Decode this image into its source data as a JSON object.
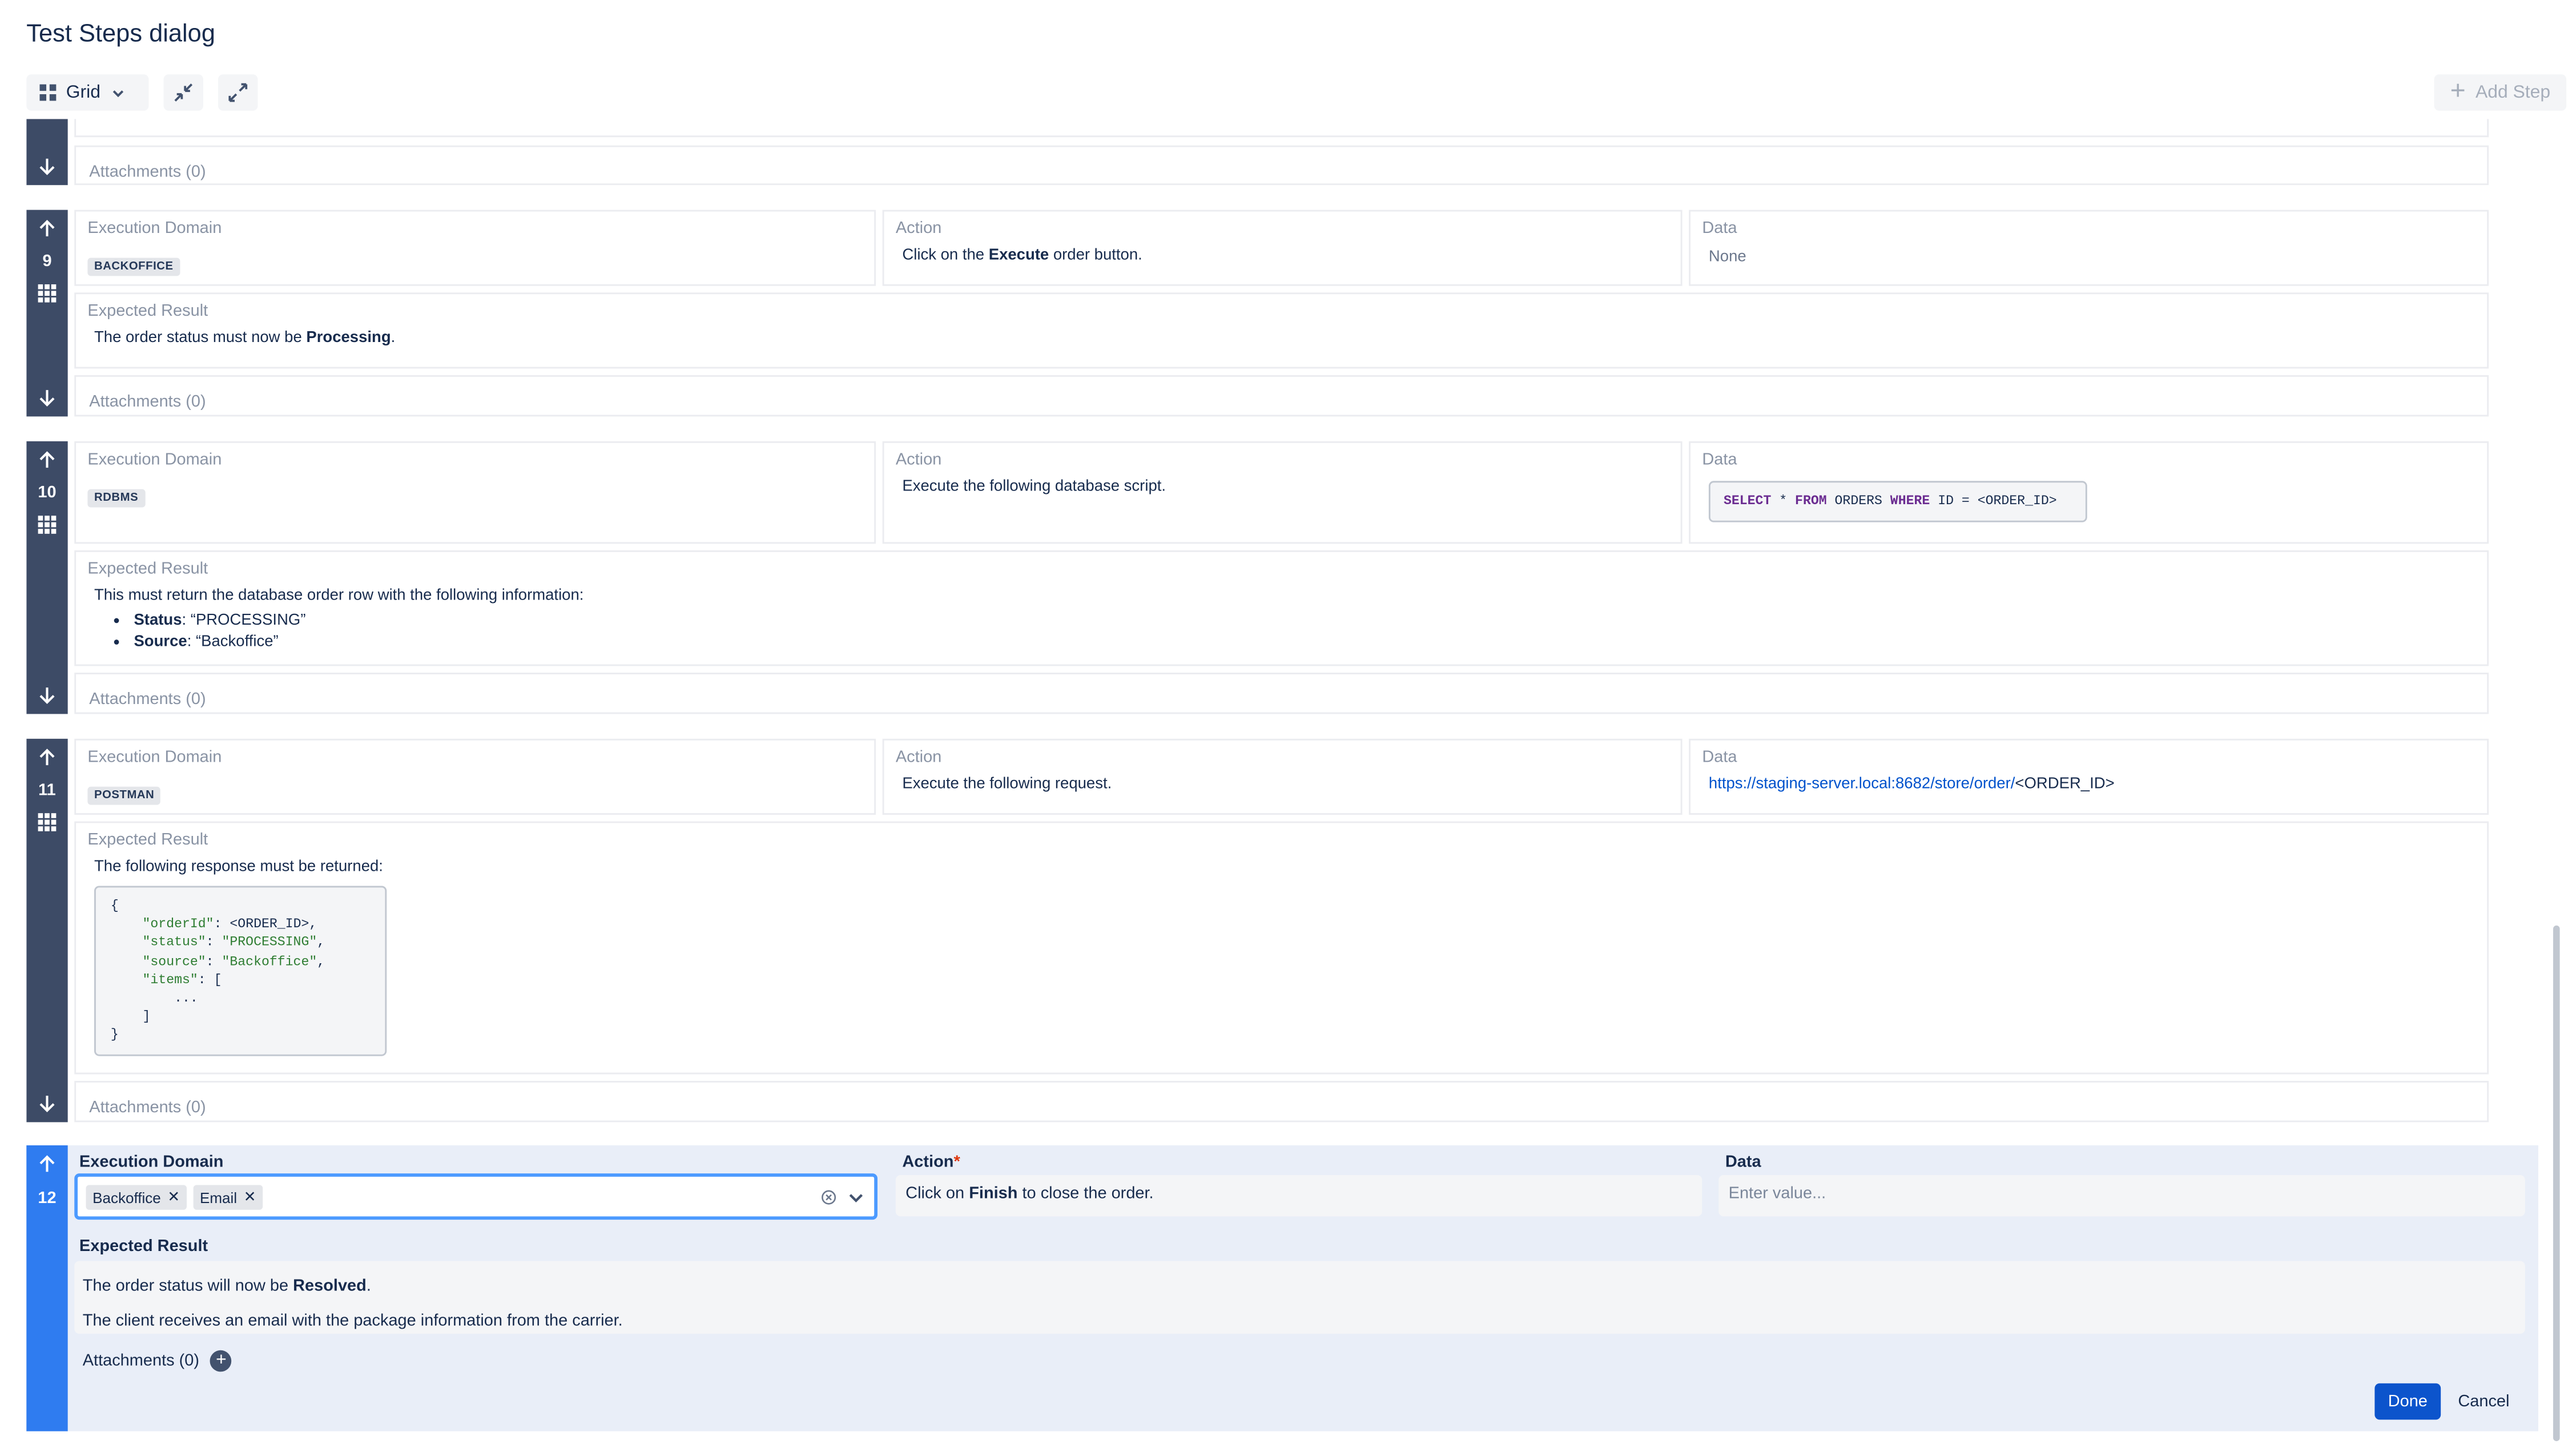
{
  "dialog": {
    "title": "Test Steps dialog"
  },
  "toolbar": {
    "view_label": "Grid",
    "add_step_label": "Add Step"
  },
  "labels": {
    "execution_domain": "Execution Domain",
    "action": "Action",
    "data": "Data",
    "expected_result": "Expected Result",
    "attachments": "Attachments (0)"
  },
  "steps": [
    {
      "number": "9",
      "domain_tag": "BACKOFFICE",
      "action_pre": "Click on the ",
      "action_bold": "Execute",
      "action_post": " order button.",
      "data": "None",
      "er_pre": "The order status must now be ",
      "er_bold": "Processing",
      "er_post": "."
    },
    {
      "number": "10",
      "domain_tag": "RDBMS",
      "action": "Execute the following database script.",
      "data_code": {
        "kw1": "SELECT",
        "star": " * ",
        "kw2": "FROM",
        "mid": " ORDERS ",
        "kw3": "WHERE",
        "tail": " ID = <ORDER_ID>"
      },
      "er_intro": "This must return the database order row with the following information:",
      "er_items": [
        {
          "key": "Status",
          "value": ": “PROCESSING”"
        },
        {
          "key": "Source",
          "value": ": “Backoffice”"
        }
      ]
    },
    {
      "number": "11",
      "domain_tag": "POSTMAN",
      "action": "Execute the following request.",
      "data_link": "https://staging-server.local:8682/store/order/",
      "data_suffix": "<ORDER_ID>",
      "er_intro": "The following response must be returned:",
      "json": {
        "open": "{",
        "k1": "\"orderId\"",
        "v1": ": <ORDER_ID>,",
        "k2": "\"status\"",
        "v2": "\"PROCESSING\"",
        "k3": "\"source\"",
        "v3": "\"Backoffice\"",
        "k4": "\"items\"",
        "v4": ": [",
        "dots": "...",
        "bclose": "]",
        "close": "}"
      }
    }
  ],
  "editor": {
    "number": "12",
    "domain_label": "Execution Domain",
    "action_label": "Action",
    "required_mark": "*",
    "data_label": "Data",
    "chips": [
      "Backoffice",
      "Email"
    ],
    "action_pre": "Click on ",
    "action_bold": "Finish",
    "action_post": " to close the order.",
    "data_placeholder": "Enter value...",
    "er_label": "Expected Result",
    "er_line1_pre": "The order status will now be ",
    "er_line1_bold": "Resolved",
    "er_line1_post": ".",
    "er_line2": "The client receives an email with the package information from the carrier.",
    "attachments": "Attachments (0)",
    "done": "Done",
    "cancel": "Cancel"
  }
}
